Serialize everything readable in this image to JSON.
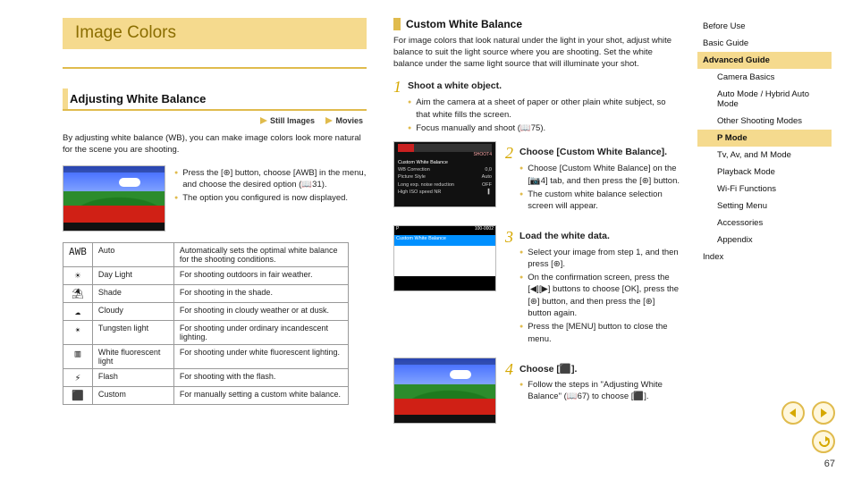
{
  "chapter_title": "Image Colors",
  "left": {
    "section": "Adjusting White Balance",
    "tag_still": "Still Images",
    "tag_movie": "Movies",
    "intro": "By adjusting white balance (WB), you can make image colors look more natural for the scene you are shooting.",
    "b1": "Press the [⊛] button, choose [AWB] in the menu, and choose the desired option (📖31).",
    "b2": "The option you configured is now displayed.",
    "table": [
      {
        "icon": "AWB",
        "name": "Auto",
        "desc": "Automatically sets the optimal white balance for the shooting conditions."
      },
      {
        "icon": "☀",
        "name": "Day Light",
        "desc": "For shooting outdoors in fair weather."
      },
      {
        "icon": "⛱",
        "name": "Shade",
        "desc": "For shooting in the shade."
      },
      {
        "icon": "☁",
        "name": "Cloudy",
        "desc": "For shooting in cloudy weather or at dusk."
      },
      {
        "icon": "✴",
        "name": "Tungsten light",
        "desc": "For shooting under ordinary incandescent lighting."
      },
      {
        "icon": "▥",
        "name": "White fluorescent light",
        "desc": "For shooting under white fluorescent lighting."
      },
      {
        "icon": "⚡",
        "name": "Flash",
        "desc": "For shooting with the flash."
      },
      {
        "icon": "⬛",
        "name": "Custom",
        "desc": "For manually setting a custom white balance."
      }
    ]
  },
  "mid": {
    "section": "Custom White Balance",
    "intro": "For image colors that look natural under the light in your shot, adjust white balance to suit the light source where you are shooting. Set the white balance under the same light source that will illuminate your shot.",
    "steps": [
      {
        "n": "1",
        "title": "Shoot a white object.",
        "bullets": [
          "Aim the camera at a sheet of paper or other plain white subject, so that white fills the screen.",
          "Focus manually and shoot (📖75)."
        ]
      },
      {
        "n": "2",
        "title": "Choose [Custom White Balance].",
        "bullets": [
          "Choose [Custom White Balance] on the [📷4] tab, and then press the [⊛] button.",
          "The custom white balance selection screen will appear."
        ]
      },
      {
        "n": "3",
        "title": "Load the white data.",
        "bullets": [
          "Select your image from step 1, and then press [⊛].",
          "On the confirmation screen, press the [◀][▶] buttons to choose [OK], press the [⊛] button, and then press the [⊛] button again.",
          "Press the [MENU] button to close the menu."
        ]
      },
      {
        "n": "4",
        "title": "Choose [⬛].",
        "bullets": [
          "Follow the steps in \"Adjusting White Balance\" (📖67) to choose [⬛]."
        ]
      }
    ],
    "menu_fig": {
      "l1": "Custom White Balance",
      "l2": "WB Correction",
      "v2": "0,0",
      "l3": "Picture Style",
      "v3": "Auto",
      "l4": "Long exp. noise reduction",
      "v4": "OFF",
      "l5": "High ISO speed NR",
      "v5": "▍"
    },
    "white_fig": {
      "tl": "P",
      "tr": "100-0002",
      "band": "Custom White Balance"
    }
  },
  "toc": {
    "items": [
      {
        "label": "Before Use"
      },
      {
        "label": "Basic Guide"
      },
      {
        "label": "Advanced Guide",
        "active": true
      },
      {
        "label": "Camera Basics",
        "lvl": 2
      },
      {
        "label": "Auto Mode / Hybrid Auto Mode",
        "lvl": 2
      },
      {
        "label": "Other Shooting Modes",
        "lvl": 2
      },
      {
        "label": "P Mode",
        "lvl": 2,
        "subactive": true
      },
      {
        "label": "Tv, Av, and M Mode",
        "lvl": 2
      },
      {
        "label": "Playback Mode",
        "lvl": 2
      },
      {
        "label": "Wi-Fi Functions",
        "lvl": 2
      },
      {
        "label": "Setting Menu",
        "lvl": 2
      },
      {
        "label": "Accessories",
        "lvl": 2
      },
      {
        "label": "Appendix",
        "lvl": 2
      },
      {
        "label": "Index"
      }
    ]
  },
  "page_number": "67"
}
